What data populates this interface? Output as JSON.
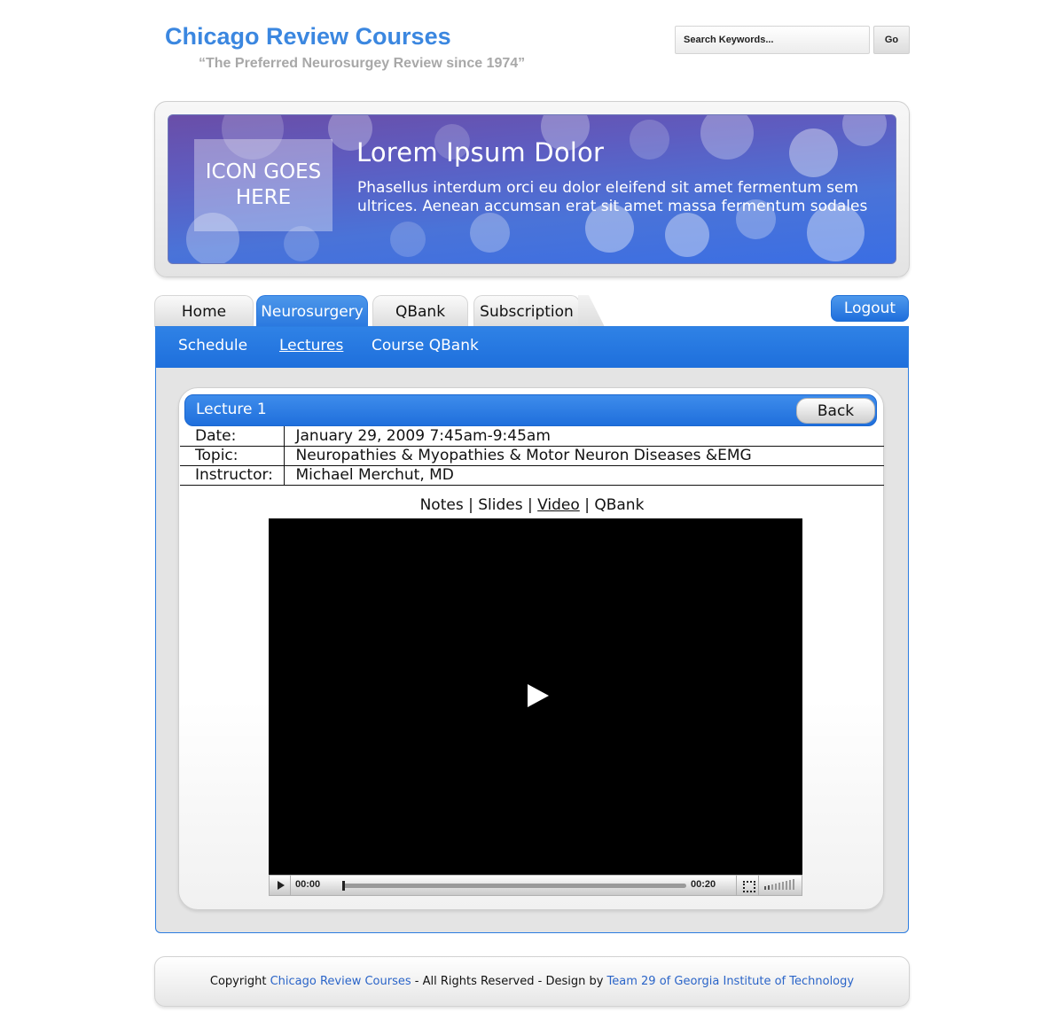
{
  "header": {
    "site_title": "Chicago Review Courses",
    "tagline": "“The Preferred Neurosurgey Review since 1974”"
  },
  "search": {
    "placeholder": "Search Keywords...",
    "button_label": "Go"
  },
  "banner": {
    "icon_placeholder": "ICON GOES HERE",
    "heading": "Lorem Ipsum Dolor",
    "text": "Phasellus interdum orci eu dolor eleifend sit amet fermentum sem ultrices. Aenean accumsan erat sit amet massa fermentum sodales"
  },
  "tabs": [
    {
      "label": "Home",
      "active": false
    },
    {
      "label": "Neurosurgery",
      "active": true
    },
    {
      "label": "QBank",
      "active": false
    },
    {
      "label": "Subscription",
      "active": false
    }
  ],
  "logout_label": "Logout",
  "subnav": [
    {
      "label": "Schedule",
      "current": false
    },
    {
      "label": "Lectures",
      "current": true
    },
    {
      "label": "Course QBank",
      "current": false
    }
  ],
  "lecture": {
    "title": "Lecture 1",
    "back_label": "Back",
    "details": [
      {
        "label": "Date:",
        "value": "January 29, 2009 7:45am-9:45am"
      },
      {
        "label": "Topic:",
        "value": "Neuropathies & Myopathies & Motor Neuron Diseases &EMG"
      },
      {
        "label": "Instructor:",
        "value": "Michael Merchut, MD"
      }
    ]
  },
  "media_links": {
    "items": [
      "Notes",
      "Slides",
      "Video",
      "QBank"
    ],
    "separator": "|",
    "current": "Video"
  },
  "player": {
    "current_time": "00:00",
    "duration": "00:20",
    "progress": 0
  },
  "footer": {
    "copyright_prefix": "Copyright",
    "company_link": "Chicago Review Courses",
    "rights_text": "- All Rights Reserved - Design by",
    "designer_link": "Team 29 of Georgia Institute of Technology"
  },
  "colors": {
    "brand_blue": "#3b87e0",
    "nav_blue": "#1e6fdc",
    "footer_link": "#2a64c8"
  }
}
